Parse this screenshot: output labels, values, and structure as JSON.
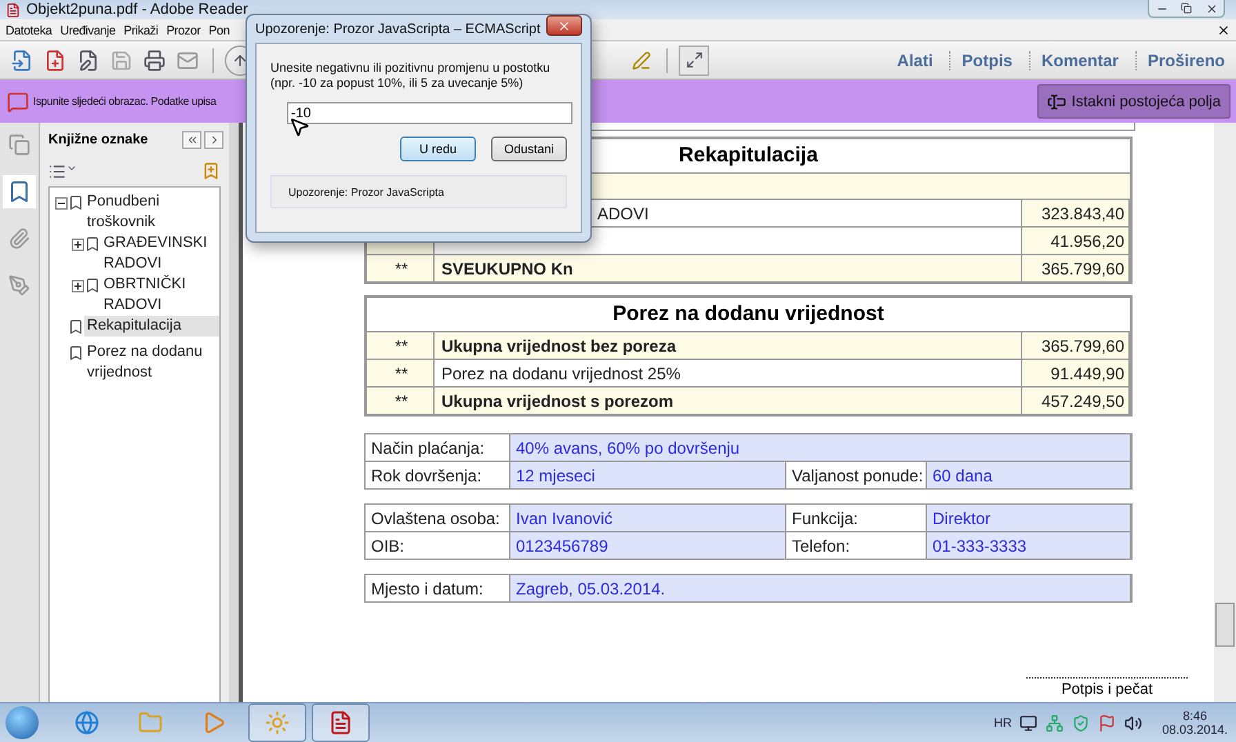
{
  "window": {
    "title": "Objekt2puna.pdf - Adobe Reader"
  },
  "menu": [
    "Datoteka",
    "Uređivanje",
    "Prikaži",
    "Prozor",
    "Pon"
  ],
  "toolbar": {
    "panes": [
      "Alati",
      "Potpis",
      "Komentar",
      "Prošireno"
    ]
  },
  "form_bar": {
    "message": "Ispunite sljedeći obrazac. Podatke upisa",
    "button": "Istakni postojeća polja"
  },
  "bookmarks": {
    "title": "Knjižne oznake",
    "items": [
      {
        "label": "Ponudbeni troškovnik",
        "selected": false,
        "expanded": true,
        "children": [
          {
            "label": "GRAĐEVINSKI RADOVI",
            "selected": false,
            "expanded": false
          },
          {
            "label": "OBRTNIČKI RADOVI",
            "selected": false,
            "expanded": false
          }
        ]
      },
      {
        "label": "Rekapitulacija",
        "selected": true
      },
      {
        "label": "Porez na dodanu vrijednost",
        "selected": false
      }
    ]
  },
  "recap": {
    "title": "Rekapitulacija",
    "rows": [
      {
        "kind": "covered",
        "label": "ADOVI",
        "amount": "323.843,40",
        "bold": false,
        "shaded": false
      },
      {
        "kind": "covered",
        "amount": "41.956,20"
      },
      {
        "kind": "full",
        "marker": "**",
        "label": "SVEUKUPNO Kn",
        "amount": "365.799,60",
        "bold": true,
        "shaded": true
      }
    ]
  },
  "vat": {
    "title": "Porez na dodanu vrijednost",
    "rows": [
      {
        "kind": "full",
        "marker": "**",
        "label": "Ukupna vrijednost bez poreza",
        "amount": "365.799,60",
        "bold": true,
        "shaded": true
      },
      {
        "kind": "full",
        "marker": "**",
        "label": "Porez na dodanu vrijednost 25%",
        "amount": "91.449,90",
        "bold": false,
        "shaded": false
      },
      {
        "kind": "full",
        "marker": "**",
        "label": "Ukupna vrijednost s porezom",
        "amount": "457.249,50",
        "bold": true,
        "shaded": true
      }
    ]
  },
  "forms": [
    {
      "rows": [
        [
          {
            "label": "Način plaćanja:",
            "value": "40% avans, 60% po dovršenju"
          }
        ],
        [
          {
            "label": "Rok dovršenja:",
            "value": "12 mjeseci"
          },
          {
            "label": "Valjanost ponude:",
            "value": "60 dana"
          }
        ]
      ]
    },
    {
      "rows": [
        [
          {
            "label": "Ovlaštena osoba:",
            "value": "Ivan Ivanović"
          },
          {
            "label": "Funkcija:",
            "value": "Direktor"
          }
        ],
        [
          {
            "label": "OIB:",
            "value": "0123456789"
          },
          {
            "label": "Telefon:",
            "value": "01-333-3333"
          }
        ]
      ]
    },
    {
      "rows": [
        [
          {
            "label": "Mjesto i datum:",
            "value": "Zagreb, 05.03.2014."
          }
        ]
      ]
    }
  ],
  "signature": "Potpis i pečat",
  "dialog": {
    "title": "Upozorenje: Prozor JavaScripta – ECMAScript",
    "prompt": "Unesite negativnu ili pozitivnu promjenu u postotku\n(npr. -10 za popust 10%, ili 5 za uvecanje 5%)",
    "value": "-10",
    "buttons": [
      "U redu",
      "Odustani"
    ],
    "footer": "Upozorenje: Prozor JavaScripta"
  },
  "taskbar": {
    "apps": [
      {
        "kind": "ie",
        "open": false
      },
      {
        "kind": "folder",
        "open": false
      },
      {
        "kind": "media",
        "open": false
      },
      {
        "kind": "clock",
        "open": true
      },
      {
        "kind": "pdf",
        "open": true
      }
    ],
    "language": "HR",
    "time": "8:46",
    "date": "08.03.2014."
  }
}
